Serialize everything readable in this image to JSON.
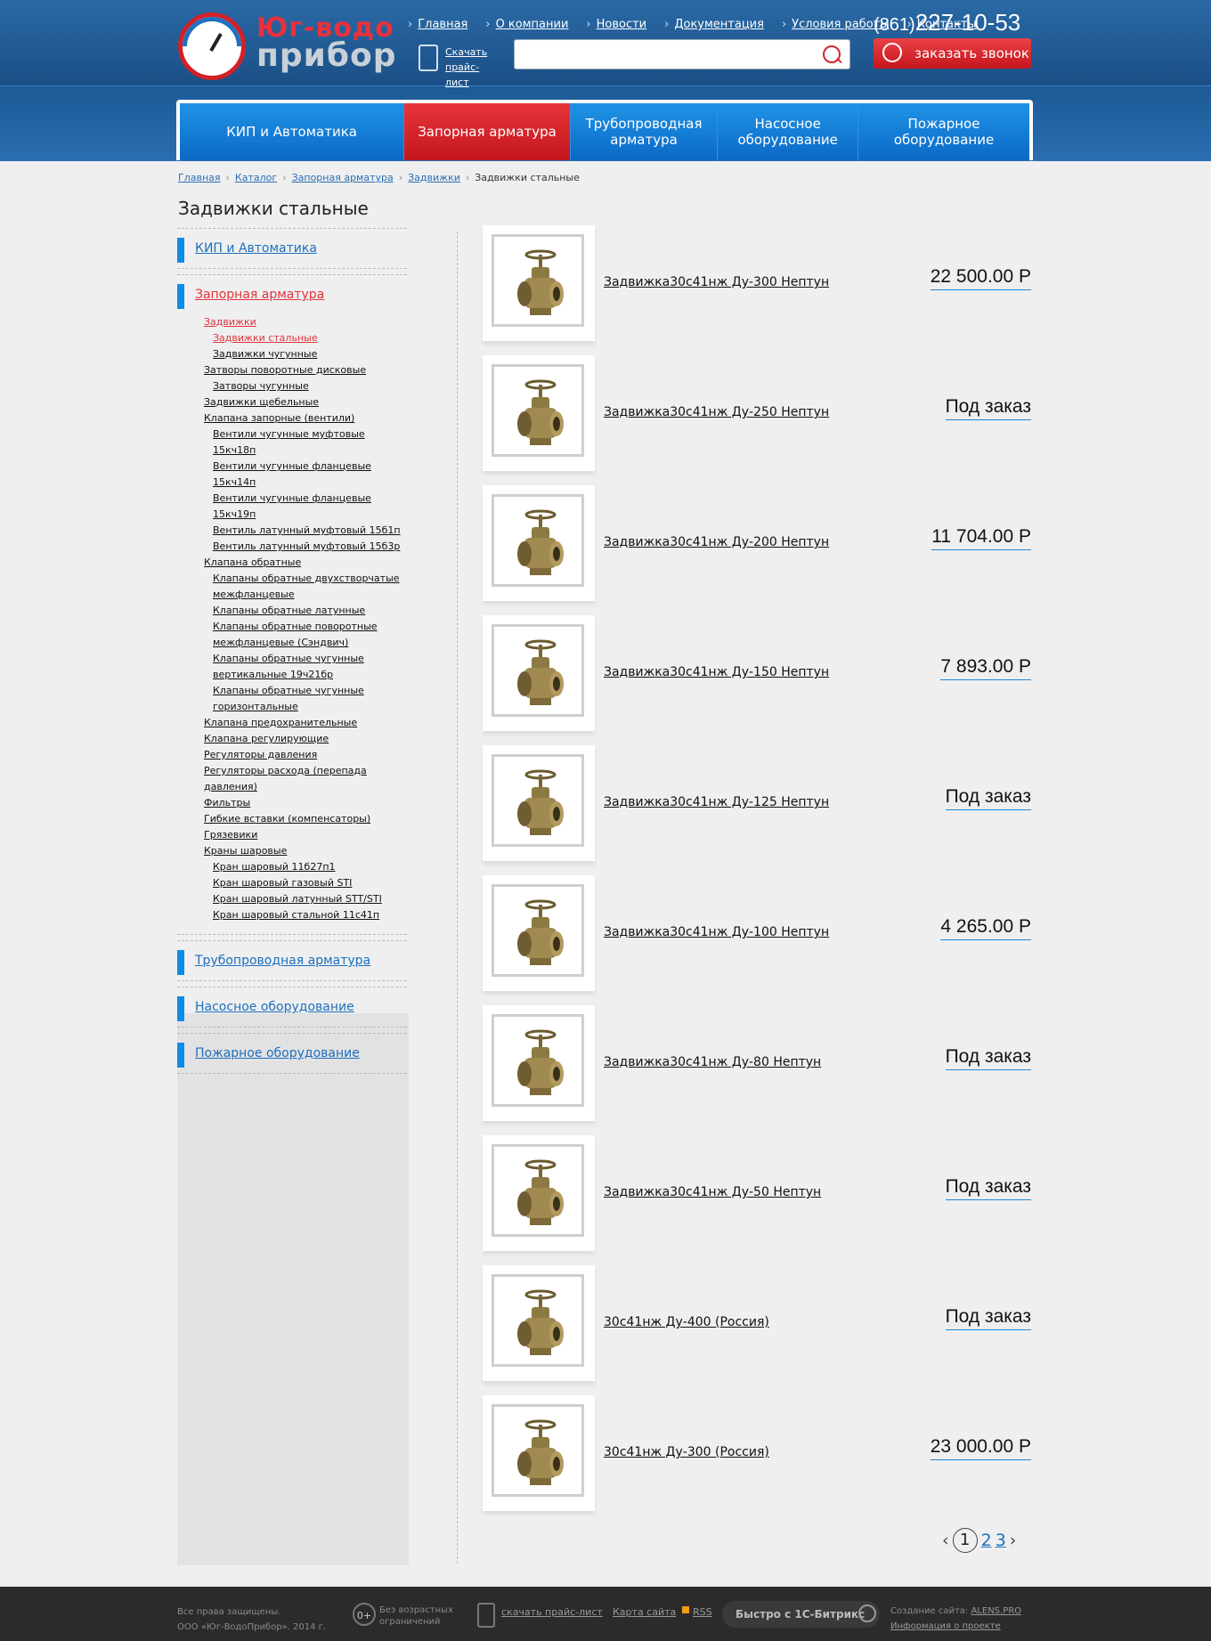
{
  "logo": {
    "line1": "Юг-водо",
    "line2": "прибор"
  },
  "topnav": [
    "Главная",
    "О компании",
    "Новости",
    "Документация",
    "Условия работы",
    "Контакты"
  ],
  "download": "Скачать прайс-лист",
  "search": {
    "placeholder": ""
  },
  "phone": {
    "code": "(861)",
    "number": "227-10-53"
  },
  "callback": "заказать звонок",
  "mainnav": [
    {
      "label": "КИП и Автоматика",
      "active": false
    },
    {
      "label": "Запорная арматура",
      "active": true
    },
    {
      "label": "Трубопроводная арматура",
      "active": false
    },
    {
      "label": "Насосное оборудование",
      "active": false
    },
    {
      "label": "Пожарное оборудование",
      "active": false
    }
  ],
  "breadcrumb": [
    "Главная",
    "Каталог",
    "Запорная арматура",
    "Задвижки",
    "Задвижки стальные"
  ],
  "page_title": "Задвижки стальные",
  "sidebar": {
    "sections": [
      "КИП и Автоматика",
      "Запорная арматура",
      "Трубопроводная арматура",
      "Насосное оборудование",
      "Пожарное оборудование"
    ],
    "subitems": [
      {
        "label": "Задвижки",
        "level": 1,
        "active": true
      },
      {
        "label": "Задвижки стальные",
        "level": 2,
        "active": true
      },
      {
        "label": "Задвижки чугунные",
        "level": 2,
        "active": false
      },
      {
        "label": "Затворы поворотные дисковые",
        "level": 1,
        "active": false
      },
      {
        "label": "Затворы чугунные",
        "level": 2,
        "active": false
      },
      {
        "label": "Задвижки щебельные",
        "level": 1,
        "active": false
      },
      {
        "label": "Клапана запорные (вентили)",
        "level": 1,
        "active": false
      },
      {
        "label": "Вентили чугунные муфтовые 15кч18п",
        "level": 2,
        "active": false
      },
      {
        "label": "Вентили чугунные фланцевые 15кч14п",
        "level": 2,
        "active": false
      },
      {
        "label": "Вентили чугунные фланцевые 15кч19п",
        "level": 2,
        "active": false
      },
      {
        "label": "Вентиль латунный муфтовый 15б1п",
        "level": 2,
        "active": false
      },
      {
        "label": "Вентиль латунный муфтовый 15б3р",
        "level": 2,
        "active": false
      },
      {
        "label": "Клапана обратные",
        "level": 1,
        "active": false
      },
      {
        "label": "Клапаны обратные двухстворчатые межфланцевые",
        "level": 2,
        "active": false
      },
      {
        "label": "Клапаны обратные латунные",
        "level": 2,
        "active": false
      },
      {
        "label": "Клапаны обратные поворотные межфланцевые (Сэндвич)",
        "level": 2,
        "active": false
      },
      {
        "label": "Клапаны обратные чугунные вертикальные 19ч21бр",
        "level": 2,
        "active": false
      },
      {
        "label": "Клапаны обратные чугунные горизонтальные",
        "level": 2,
        "active": false
      },
      {
        "label": "Клапана предохранительные",
        "level": 1,
        "active": false
      },
      {
        "label": "Клапана регулирующие",
        "level": 1,
        "active": false
      },
      {
        "label": "Регуляторы давления",
        "level": 1,
        "active": false
      },
      {
        "label": "Регуляторы расхода (перепада давления)",
        "level": 1,
        "active": false
      },
      {
        "label": "Фильтры",
        "level": 1,
        "active": false
      },
      {
        "label": "Гибкие вставки (компенсаторы)",
        "level": 1,
        "active": false
      },
      {
        "label": "Грязевики",
        "level": 1,
        "active": false
      },
      {
        "label": "Краны шаровые",
        "level": 1,
        "active": false
      },
      {
        "label": "Кран шаровый 11б27п1",
        "level": 2,
        "active": false
      },
      {
        "label": "Кран шаровый газовый STI",
        "level": 2,
        "active": false
      },
      {
        "label": "Кран шаровый латунный STT/STI",
        "level": 2,
        "active": false
      },
      {
        "label": "Кран шаровый стальной 11с41п",
        "level": 2,
        "active": false
      }
    ]
  },
  "products": [
    {
      "name": "Задвижка30с41нж Ду-300 Нептун",
      "price": "22 500.00 Р"
    },
    {
      "name": "Задвижка30с41нж Ду-250 Нептун",
      "price": "Под заказ"
    },
    {
      "name": "Задвижка30с41нж Ду-200 Нептун",
      "price": "11 704.00 Р"
    },
    {
      "name": "Задвижка30с41нж Ду-150 Нептун",
      "price": "7 893.00 Р"
    },
    {
      "name": "Задвижка30с41нж Ду-125 Нептун",
      "price": "Под заказ"
    },
    {
      "name": "Задвижка30с41нж Ду-100 Нептун",
      "price": "4 265.00 Р"
    },
    {
      "name": "Задвижка30с41нж Ду-80 Нептун",
      "price": "Под заказ"
    },
    {
      "name": "Задвижка30с41нж Ду-50 Нептун",
      "price": "Под заказ"
    },
    {
      "name": "30с41нж Ду-400 (Россия)",
      "price": "Под заказ"
    },
    {
      "name": "30с41нж Ду-300 (Россия)",
      "price": "23 000.00 Р"
    }
  ],
  "pager": {
    "prev": "‹",
    "current": "1",
    "pages": [
      "2",
      "3"
    ],
    "next": "›"
  },
  "footer": {
    "rights1": "Все права защищены.",
    "rights2": "ООО «Юг-ВодоПрибор». 2014 г.",
    "age": "0+",
    "age_text1": "Без возрастных",
    "age_text2": "ограничений",
    "download": "скачать прайс-лист",
    "sitemap": "Карта сайта",
    "rss": "RSS",
    "bitrix": "Быстро с 1С-Битрикс",
    "credit_label": "Создание сайта:",
    "credit_link": "ALENS.PRO",
    "info": "Информация о проекте"
  },
  "colors": {
    "accent_red": "#d3262e",
    "accent_blue": "#0d8ce8",
    "header_blue": "#1f5a93"
  }
}
